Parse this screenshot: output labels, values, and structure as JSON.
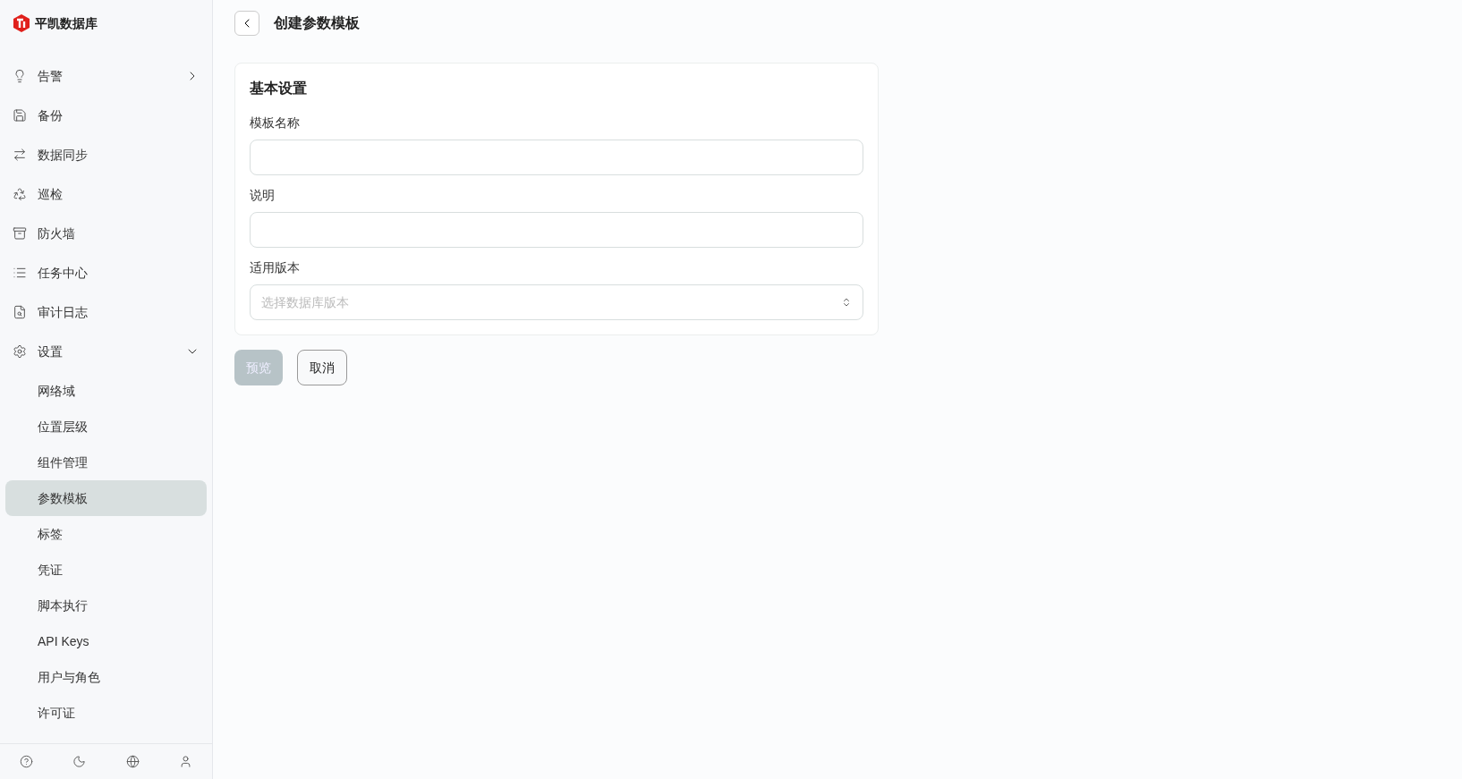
{
  "brand": {
    "name": "平凯数据库"
  },
  "sidebar": {
    "items": [
      {
        "label": "告警",
        "expanded": false
      },
      {
        "label": "备份"
      },
      {
        "label": "数据同步"
      },
      {
        "label": "巡检"
      },
      {
        "label": "防火墙"
      },
      {
        "label": "任务中心"
      },
      {
        "label": "审计日志"
      },
      {
        "label": "设置",
        "expanded": true,
        "children": [
          {
            "label": "网络域",
            "selected": false
          },
          {
            "label": "位置层级",
            "selected": false
          },
          {
            "label": "组件管理",
            "selected": false
          },
          {
            "label": "参数模板",
            "selected": true
          },
          {
            "label": "标签",
            "selected": false
          },
          {
            "label": "凭证",
            "selected": false
          },
          {
            "label": "脚本执行",
            "selected": false
          },
          {
            "label": "API Keys",
            "selected": false
          },
          {
            "label": "用户与角色",
            "selected": false
          },
          {
            "label": "许可证",
            "selected": false
          }
        ]
      }
    ]
  },
  "page": {
    "title": "创建参数模板"
  },
  "card": {
    "title": "基本设置",
    "fields": [
      {
        "kind": "input",
        "label": "模板名称"
      },
      {
        "kind": "input",
        "label": "说明"
      },
      {
        "kind": "select",
        "label": "适用版本",
        "placeholder": "选择数据库版本"
      }
    ]
  },
  "buttons": [
    {
      "label": "预览",
      "kind": "primary",
      "disabled": true
    },
    {
      "label": "取消",
      "kind": "secondary",
      "disabled": false
    }
  ]
}
